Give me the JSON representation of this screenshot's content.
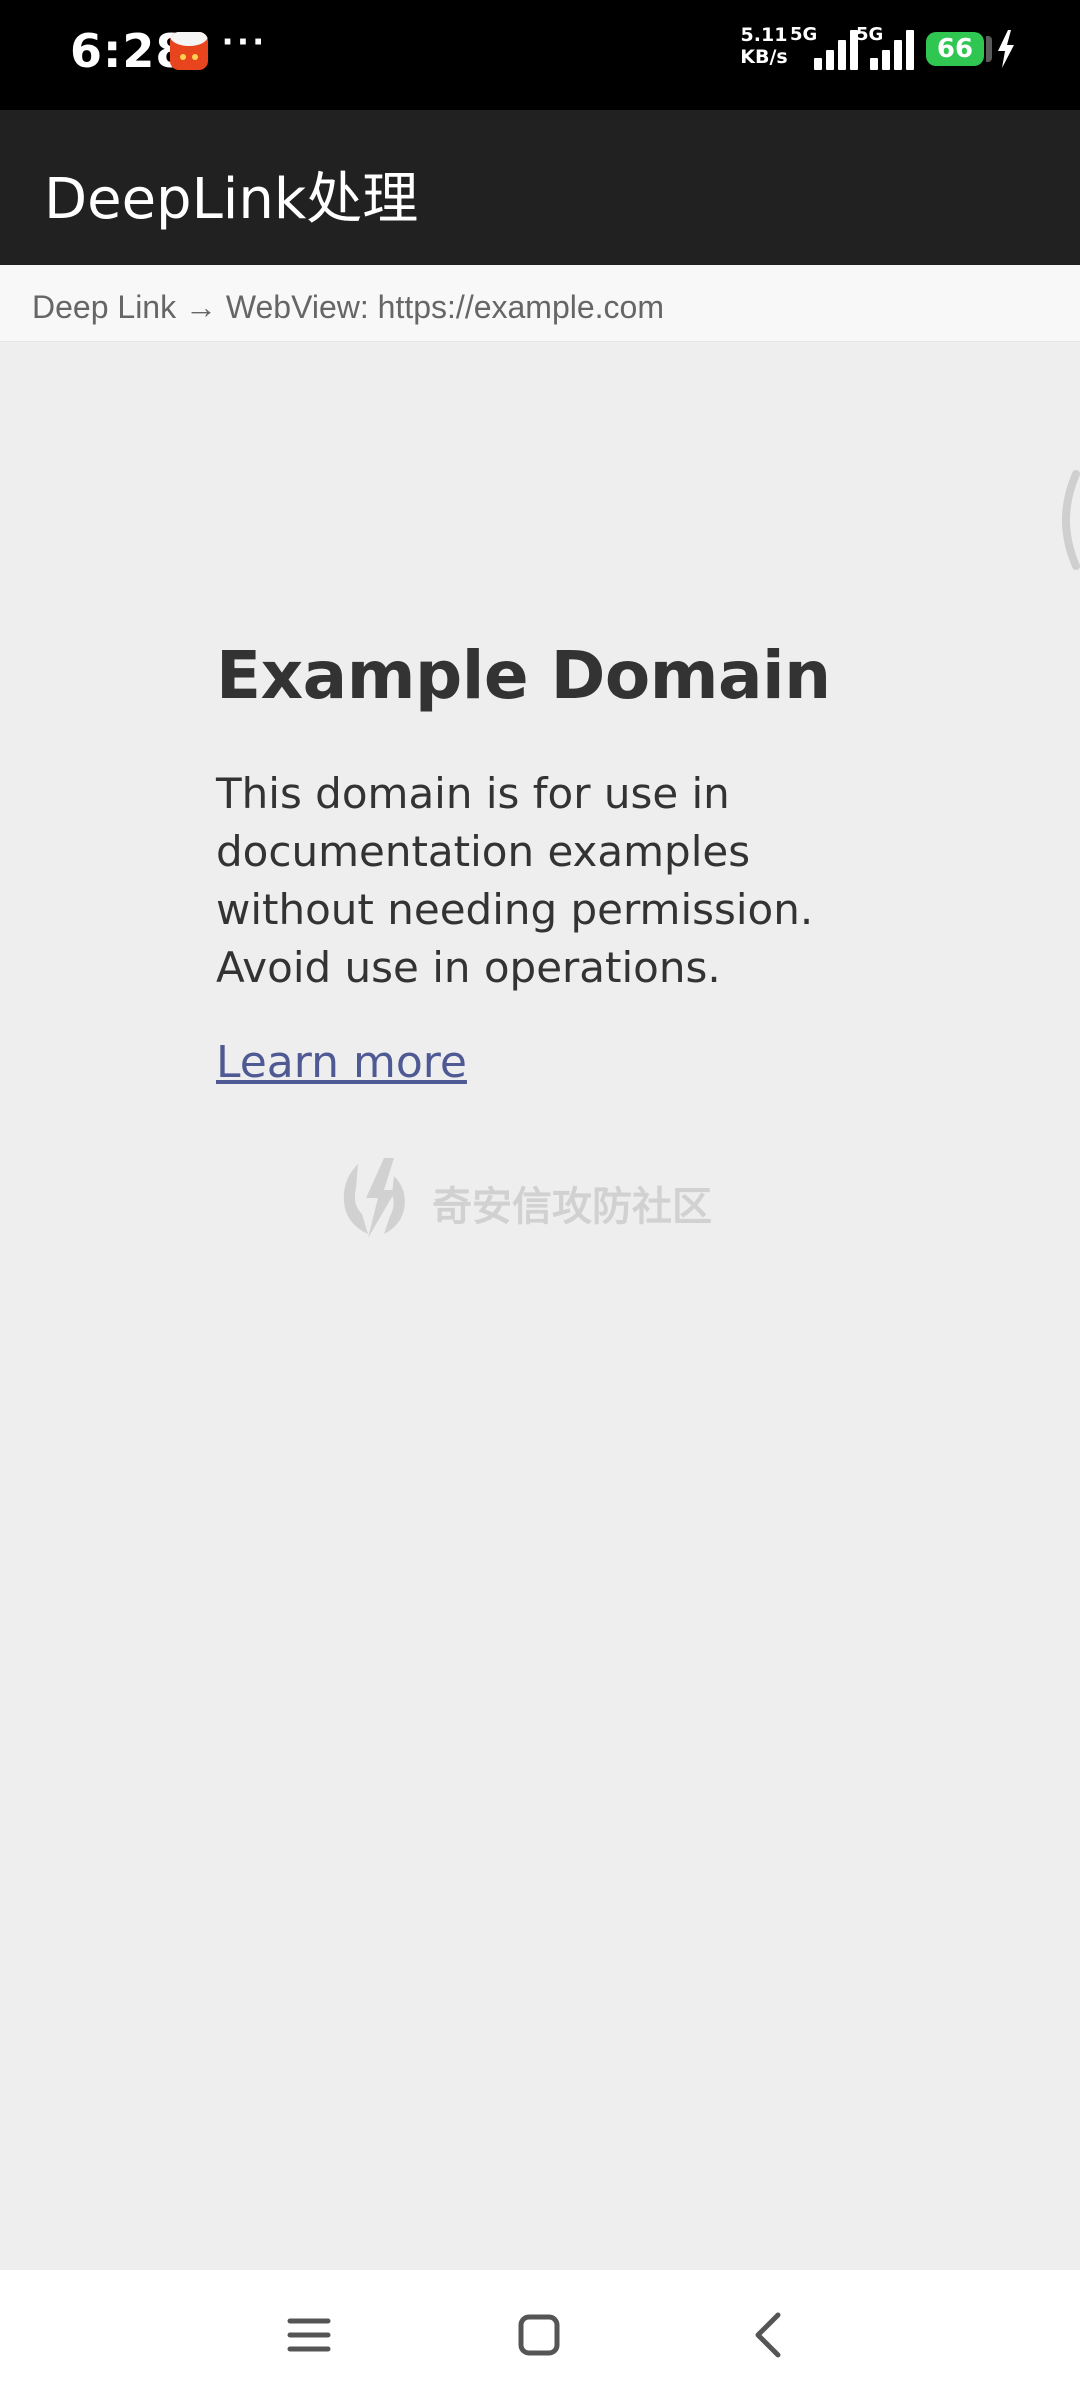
{
  "status_bar": {
    "time": "6:28",
    "more_indicator": "···",
    "net_speed_value": "5.11",
    "net_speed_unit": "KB/s",
    "signals": [
      {
        "label": "5G"
      },
      {
        "label": "5G"
      }
    ],
    "battery_level": "66",
    "icons": [
      "notification-app-icon",
      "signal-icon",
      "battery-icon",
      "charging-icon"
    ]
  },
  "app_bar": {
    "title": "DeepLink处理"
  },
  "url_strip": {
    "text": "Deep Link → WebView: https://example.com"
  },
  "webview": {
    "heading": "Example Domain",
    "paragraph": "This domain is for use in documentation examples without needing permission. Avoid use in operations.",
    "link_text": "Learn more",
    "watermark": "奇安信攻防社区",
    "link_color": "#4f5a94"
  },
  "nav_bar": {
    "buttons": [
      "menu-icon",
      "home-icon",
      "back-icon"
    ]
  },
  "colors": {
    "status_bar_bg": "#000000",
    "app_bar_bg": "#212121",
    "page_bg": "#eeeeee",
    "battery": "#2fc752"
  }
}
